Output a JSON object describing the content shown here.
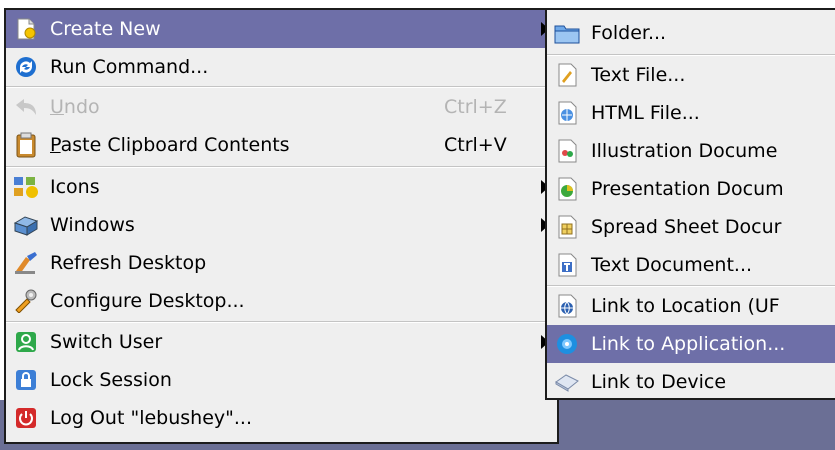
{
  "top_caption": "",
  "main_menu": {
    "items": [
      {
        "label": "Create New",
        "shortcut": "",
        "icon": "create-new-icon"
      },
      {
        "label": "Run Command...",
        "shortcut": "",
        "icon": "run-command-icon"
      },
      {
        "label": "Undo",
        "shortcut": "Ctrl+Z",
        "icon": "undo-icon"
      },
      {
        "label": "Paste Clipboard Contents",
        "shortcut": "Ctrl+V",
        "icon": "clipboard-icon"
      },
      {
        "label": "Icons",
        "shortcut": "",
        "icon": "icons-icon"
      },
      {
        "label": "Windows",
        "shortcut": "",
        "icon": "windows-icon"
      },
      {
        "label": "Refresh Desktop",
        "shortcut": "",
        "icon": "refresh-desktop-icon"
      },
      {
        "label": "Configure Desktop...",
        "shortcut": "",
        "icon": "configure-desktop-icon"
      },
      {
        "label": "Switch User",
        "shortcut": "",
        "icon": "switch-user-icon"
      },
      {
        "label": "Lock Session",
        "shortcut": "",
        "icon": "lock-session-icon"
      },
      {
        "label": "Log Out \"lebushey\"...",
        "shortcut": "",
        "icon": "log-out-icon"
      }
    ]
  },
  "sub_menu": {
    "items": [
      {
        "label": "Folder...",
        "icon": "folder-icon"
      },
      {
        "label": "Text File...",
        "icon": "text-file-icon"
      },
      {
        "label": "HTML File...",
        "icon": "html-file-icon"
      },
      {
        "label": "Illustration Docume",
        "icon": "illustration-icon"
      },
      {
        "label": "Presentation Docum",
        "icon": "presentation-icon"
      },
      {
        "label": "Spread Sheet Docur",
        "icon": "spreadsheet-icon"
      },
      {
        "label": "Text Document...",
        "icon": "text-document-icon"
      },
      {
        "label": "Link to Location (UF",
        "icon": "link-location-icon"
      },
      {
        "label": "Link to Application...",
        "icon": "link-application-icon"
      },
      {
        "label": "Link to Device",
        "icon": "link-device-icon"
      }
    ]
  },
  "colors": {
    "highlight": "#6e6fa8",
    "menu_bg": "#efefef",
    "desktop": "#6b6f95",
    "disabled_text": "#b4b4b4"
  }
}
